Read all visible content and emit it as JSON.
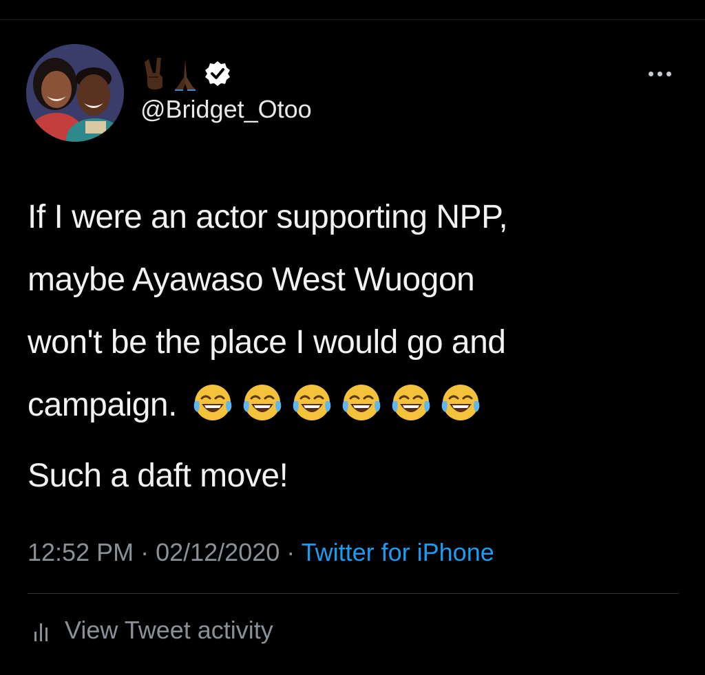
{
  "tweet": {
    "display_name_icons": [
      "victory-hand-icon",
      "praying-hands-icon",
      "verified-badge-icon"
    ],
    "handle": "@Bridget_Otoo",
    "text_lines": [
      "If I were an actor supporting NPP,",
      "maybe Ayawaso West Wuogon",
      "won't be the place I would go and",
      "campaign."
    ],
    "laugh_emoji_count": 6,
    "text_second_paragraph": "Such a daft move!",
    "time": "12:52 PM",
    "separator": " · ",
    "date": "02/12/2020",
    "source": "Twitter for iPhone",
    "activity_label": "View Tweet activity"
  },
  "icons": {
    "more": "more-options-icon",
    "laugh": "face-with-tears-of-joy-icon",
    "activity": "bar-chart-icon"
  },
  "colors": {
    "background": "#000000",
    "text": "#e7e9ea",
    "secondary": "#8b9096",
    "link": "#1d9bf0",
    "divider": "#2f3336"
  }
}
